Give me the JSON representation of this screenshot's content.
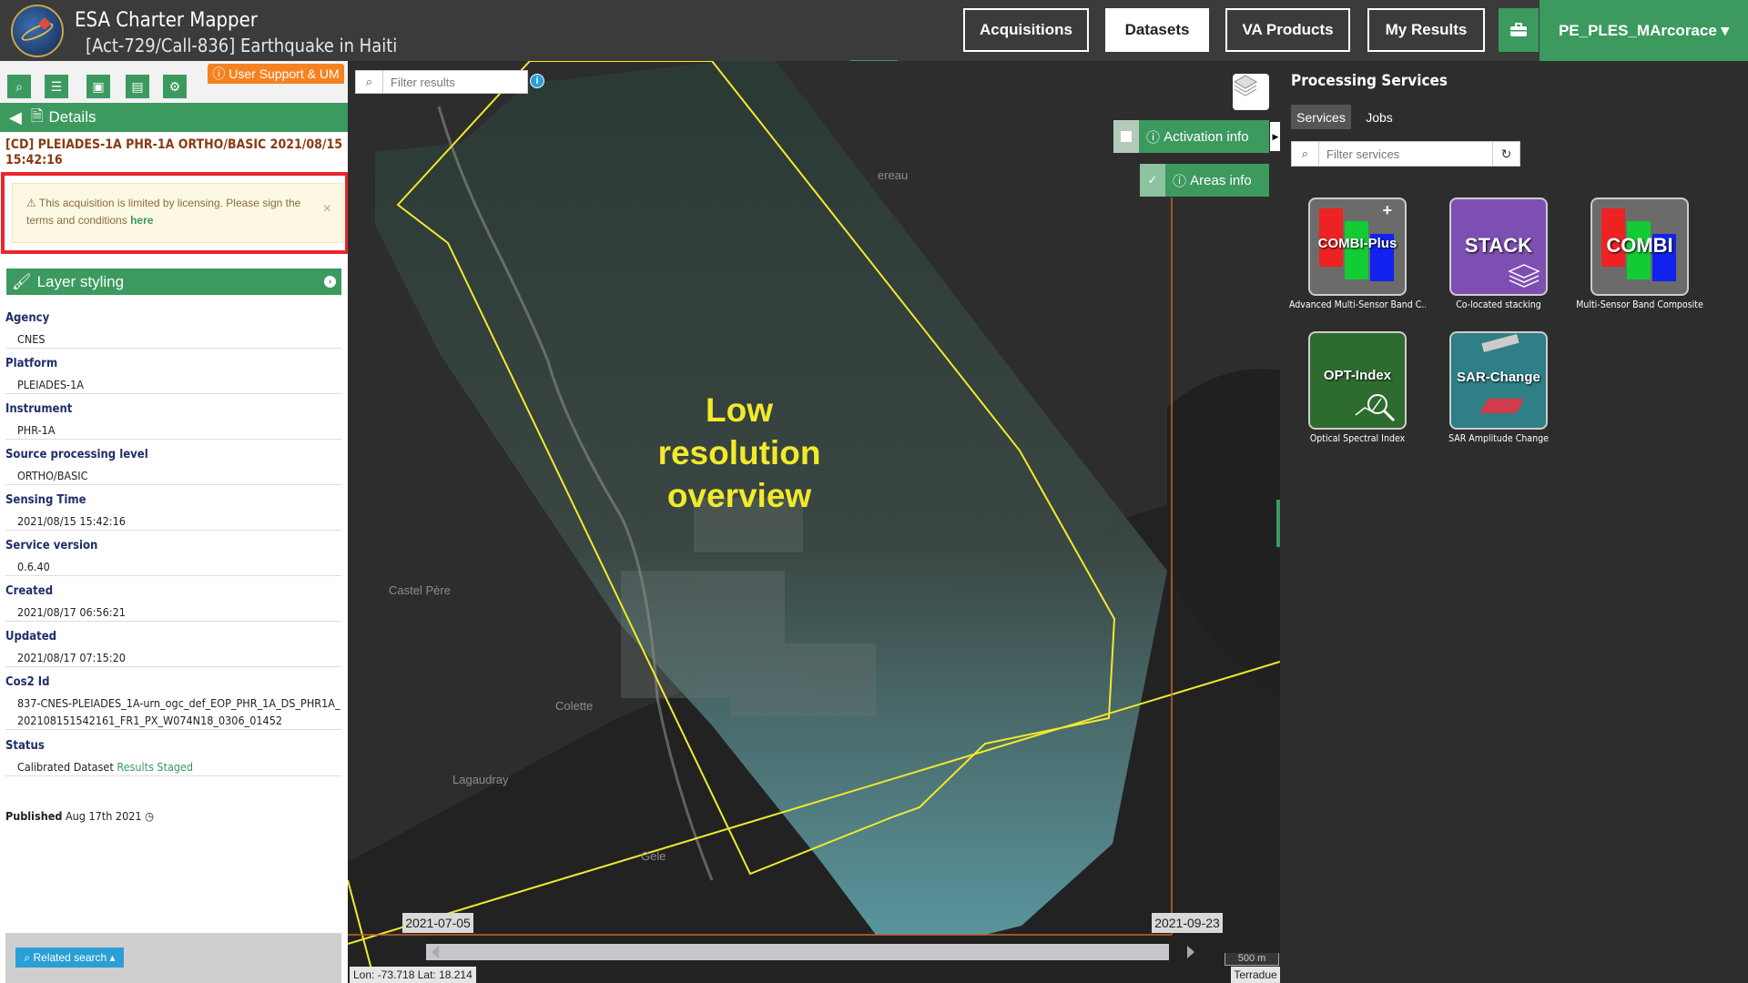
{
  "header": {
    "app_title": "ESA Charter Mapper",
    "subtitle": "[Act-729/Call-836] Earthquake in Haiti",
    "nav": [
      "Acquisitions",
      "Datasets",
      "VA Products",
      "My Results"
    ],
    "active_nav": "Datasets",
    "user": "PE_PLES_MArcorace ▾"
  },
  "left_panel": {
    "support_label": "User Support & UM",
    "details_label": "Details",
    "acquisition_title": "[CD] PLEIADES-1A PHR-1A ORTHO/BASIC 2021/08/15 15:42:16",
    "alert_text": "This acquisition is limited by licensing. Please sign the terms and conditions",
    "alert_link": "here",
    "layer_styling": "Layer styling",
    "fields": [
      {
        "label": "Agency",
        "value": "CNES"
      },
      {
        "label": "Platform",
        "value": "PLEIADES-1A"
      },
      {
        "label": "Instrument",
        "value": "PHR-1A"
      },
      {
        "label": "Source processing level",
        "value": "ORTHO/BASIC"
      },
      {
        "label": "Sensing Time",
        "value": "2021/08/15 15:42:16"
      },
      {
        "label": "Service version",
        "value": "0.6.40"
      },
      {
        "label": "Created",
        "value": "2021/08/17 06:56:21"
      },
      {
        "label": "Updated",
        "value": "2021/08/17 07:15:20"
      },
      {
        "label": "Cos2 Id",
        "value": "837-CNES-PLEIADES_1A-urn_ogc_def_EOP_PHR_1A_DS_PHR1A_202108151542161_FR1_PX_W074N18_0306_01452"
      }
    ],
    "status_label": "Status",
    "status_value": "Calibrated Dataset",
    "status_link": "Results Staged",
    "published_label": "Published",
    "published_date": "Aug 17th 2021",
    "related_search": "Related search ▴"
  },
  "map": {
    "filter_placeholder": "Filter results",
    "activation_info": "Activation info",
    "areas_info": "Areas info",
    "overview_text": [
      "Low",
      "resolution",
      "overview"
    ],
    "places": [
      "ereau",
      "Castel Père",
      "Colette",
      "Lagaudray",
      "Gele"
    ],
    "date_start": "2021-07-05",
    "date_end": "2021-09-23",
    "scale": "500 m",
    "coords": "Lon: -73.718 Lat: 18.214",
    "attribution": "Terradue"
  },
  "processing": {
    "title": "Processing Services",
    "tabs": [
      "Services",
      "Jobs"
    ],
    "filter_placeholder": "Filter services",
    "services": [
      {
        "name": "COMBI-Plus",
        "caption": "Advanced Multi-Sensor Band C..."
      },
      {
        "name": "STACK",
        "caption": "Co-located stacking"
      },
      {
        "name": "COMBI",
        "caption": "Multi-Sensor Band Composite"
      },
      {
        "name": "OPT-Index",
        "caption": "Optical Spectral Index"
      },
      {
        "name": "SAR-Change",
        "caption": "SAR Amplitude Change"
      }
    ]
  },
  "colors": {
    "accent": "#3c9a5f",
    "alert_border": "#e8262b",
    "footprint": "#f2ea2a",
    "support": "#f58220"
  }
}
